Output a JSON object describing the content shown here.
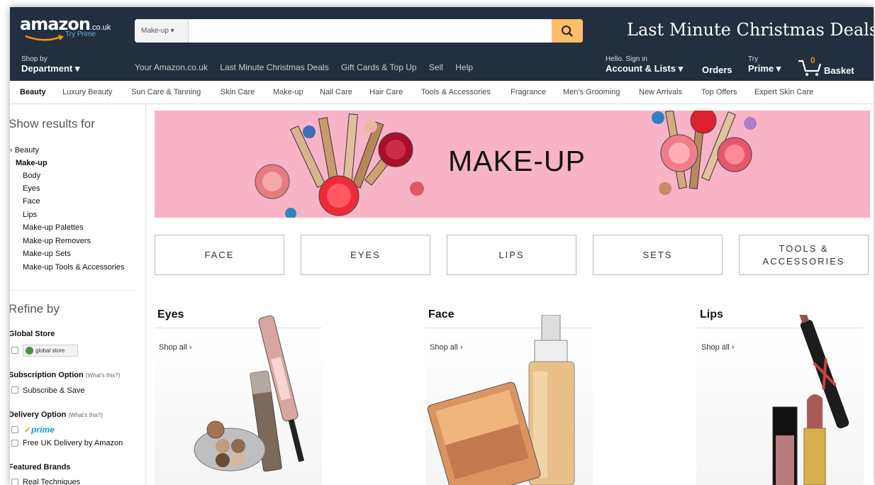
{
  "header": {
    "logo_text": "amazon",
    "logo_tld": ".co.uk",
    "logo_prime": "Try Prime",
    "search_category": "Make-up ▾",
    "search_value": "",
    "promo": "Last Minute Christmas Deals"
  },
  "nav": {
    "dept_line1": "Shop by",
    "dept_line2": "Department ▾",
    "links": [
      "Your Amazon.co.uk",
      "Last Minute Christmas Deals",
      "Gift Cards & Top Up",
      "Sell",
      "Help"
    ],
    "account_line1": "Hello. Sign in",
    "account_line2": "Account & Lists ▾",
    "orders": "Orders",
    "prime_line1": "Try",
    "prime_line2": "Prime ▾",
    "basket_count": "0",
    "basket_label": "Basket"
  },
  "subnav": [
    "Beauty",
    "Luxury Beauty",
    "Sun Care & Tanning",
    "Skin Care",
    "Make-up",
    "Nail Care",
    "Hair Care",
    "Tools & Accessories",
    "Fragrance",
    "Men's Grooming",
    "New Arrivals",
    "Top Offers",
    "Expert Skin Care"
  ],
  "sidebar": {
    "show_results": "Show results for",
    "beauty": "‹ Beauty",
    "makeup": "Make-up",
    "categories": [
      "Body",
      "Eyes",
      "Face",
      "Lips",
      "Make-up Palettes",
      "Make-up Removers",
      "Make-up Sets",
      "Make-up Tools & Accessories"
    ],
    "refine": "Refine by",
    "global_store_h": "Global Store",
    "global_store_badge": "global store",
    "subscription_h": "Subscription Option",
    "subscription_note": "(What's this?)",
    "subscribe_save": "Subscribe & Save",
    "delivery_h": "Delivery Option",
    "delivery_note": "(What's this?)",
    "prime_check": "✓",
    "prime_word": "prime",
    "free_delivery": "Free UK Delivery by Amazon",
    "brands_h": "Featured Brands",
    "brand1": "Real Techniques"
  },
  "banner": {
    "title": "MAKE-UP"
  },
  "tiles": [
    "FACE",
    "EYES",
    "LIPS",
    "SETS",
    "TOOLS & ACCESSORIES"
  ],
  "columns": [
    {
      "title": "Eyes",
      "link": "Shop all ›"
    },
    {
      "title": "Face",
      "link": "Shop all ›"
    },
    {
      "title": "Lips",
      "link": "Shop all ›"
    }
  ],
  "colors": {
    "nav": "#232f3e",
    "search_button": "#febd69",
    "banner": "#f9b3c7",
    "prime_blue": "#1a98d4",
    "basket_orange": "#f08804"
  },
  "icons": [
    "search-icon",
    "cart-icon",
    "amazon-smile-icon",
    "chevron-down-icon"
  ]
}
